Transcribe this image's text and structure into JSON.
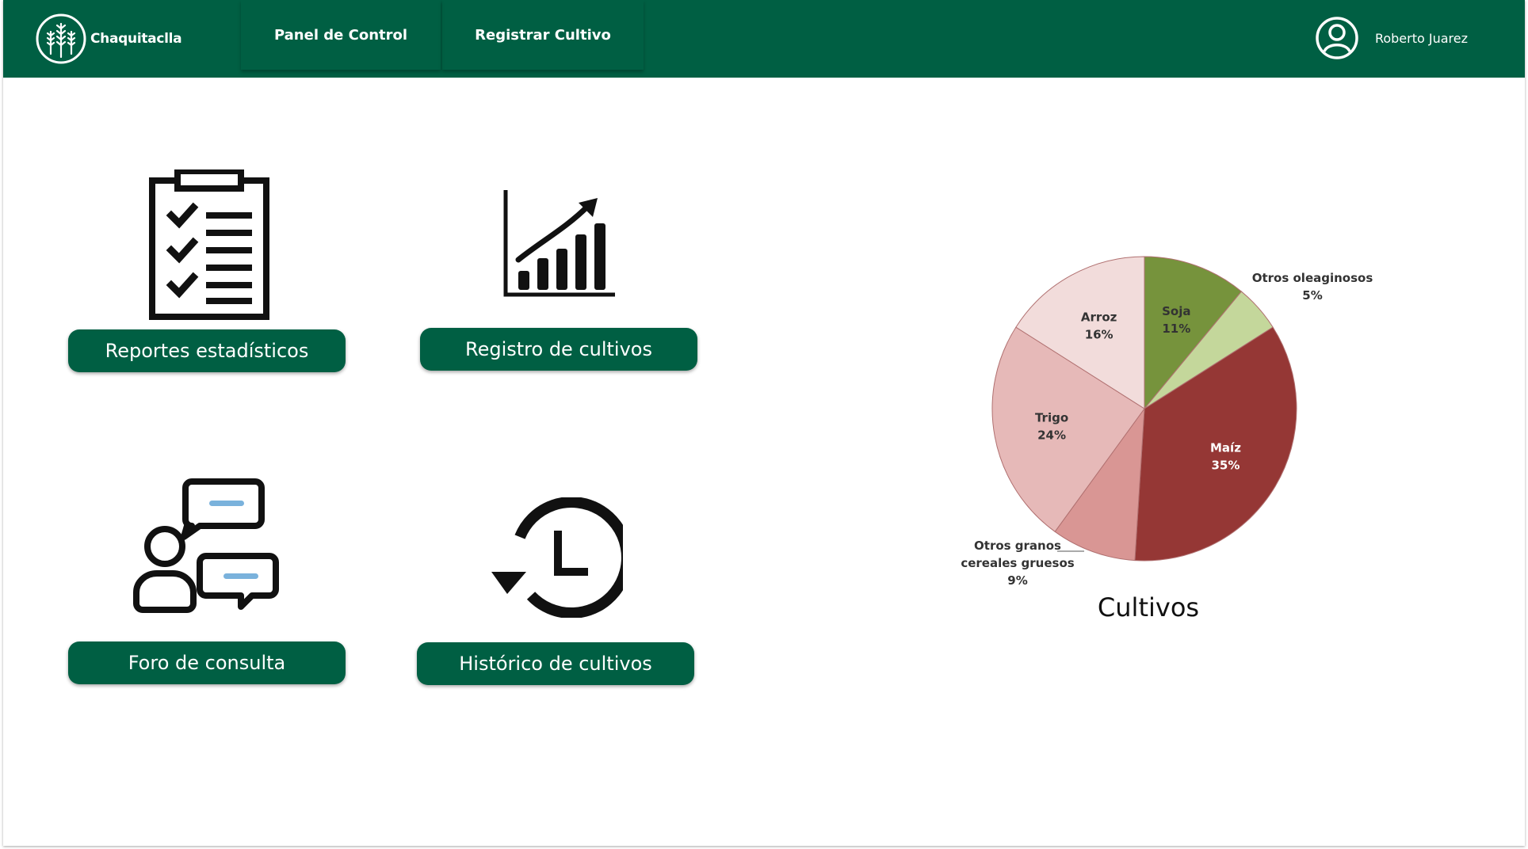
{
  "app": {
    "name": "Chaquitaclla"
  },
  "nav": {
    "items": [
      {
        "label": "Panel de Control"
      },
      {
        "label": "Registrar Cultivo"
      }
    ]
  },
  "user": {
    "name": "Roberto Juarez",
    "icon": "user-circle-icon"
  },
  "actions": [
    {
      "label": "Reportes estadísticos",
      "icon": "clipboard-checklist-icon"
    },
    {
      "label": "Registro de cultivos",
      "icon": "growth-chart-icon"
    },
    {
      "label": "Foro de consulta",
      "icon": "chat-users-icon"
    },
    {
      "label": "Histórico de cultivos",
      "icon": "history-clock-icon"
    }
  ],
  "colors": {
    "brand": "#005f43"
  },
  "chart_data": {
    "type": "pie",
    "title": "Cultivos",
    "slices": [
      {
        "label": "Soja",
        "value": 11,
        "display": "11%",
        "color": "#76933c"
      },
      {
        "label": "Otros oleaginosos",
        "value": 5,
        "display": "5%",
        "color": "#c4d79b"
      },
      {
        "label": "Maíz",
        "value": 35,
        "display": "35%",
        "color": "#953735"
      },
      {
        "label": "Otros granos cereales gruesos",
        "value": 9,
        "display": "9%",
        "color": "#d99694"
      },
      {
        "label": "Trigo",
        "value": 24,
        "display": "24%",
        "color": "#e6b9b8"
      },
      {
        "label": "Arroz",
        "value": 16,
        "display": "16%",
        "color": "#f2dcdb"
      }
    ]
  }
}
